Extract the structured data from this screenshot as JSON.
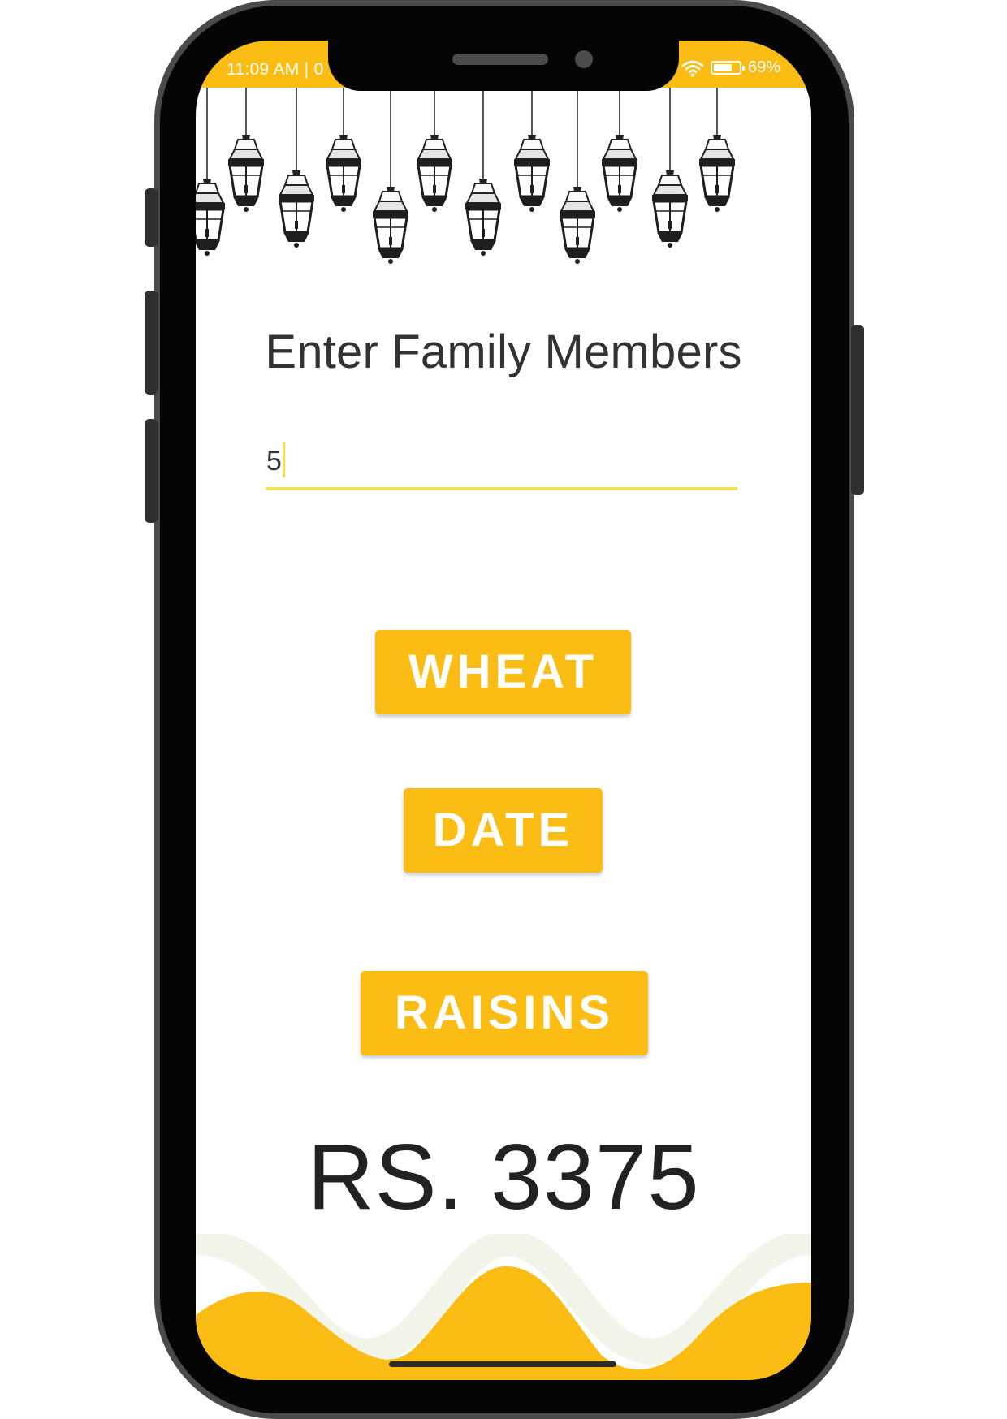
{
  "status_bar": {
    "time": "11:09 AM | 0",
    "battery": "69%"
  },
  "main": {
    "title": "Enter Family Members",
    "family_input_value": "5"
  },
  "buttons": {
    "wheat": "WHEAT",
    "date": "DATE",
    "raisins": "RAISINS"
  },
  "result": {
    "total": "RS. 3375"
  },
  "colors": {
    "accent": "#fbbd13",
    "input_underline": "#f2e35c",
    "wave_light": "#f3f4e9",
    "text_dark": "#333333"
  }
}
